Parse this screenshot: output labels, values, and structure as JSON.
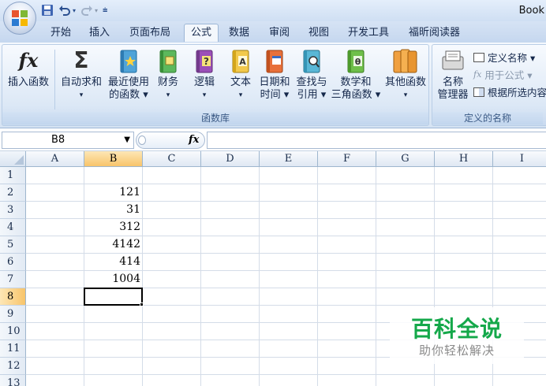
{
  "window": {
    "title": "Book"
  },
  "quick_access": {
    "icons": [
      "save-icon",
      "undo-icon",
      "redo-icon",
      "customize-icon"
    ]
  },
  "tabs": [
    {
      "label": "开始"
    },
    {
      "label": "插入"
    },
    {
      "label": "页面布局"
    },
    {
      "label": "公式",
      "active": true
    },
    {
      "label": "数据"
    },
    {
      "label": "审阅"
    },
    {
      "label": "视图"
    },
    {
      "label": "开发工具"
    },
    {
      "label": "福昕阅读器"
    }
  ],
  "ribbon": {
    "function_library": {
      "label": "函数库",
      "buttons": [
        {
          "line1": "插入函数",
          "line2": ""
        },
        {
          "line1": "自动求和",
          "line2": "▾"
        },
        {
          "line1": "最近使用",
          "line2": "的函数 ▾"
        },
        {
          "line1": "财务",
          "line2": "▾"
        },
        {
          "line1": "逻辑",
          "line2": "▾"
        },
        {
          "line1": "文本",
          "line2": "▾"
        },
        {
          "line1": "日期和",
          "line2": "时间 ▾"
        },
        {
          "line1": "查找与",
          "line2": "引用 ▾"
        },
        {
          "line1": "数学和",
          "line2": "三角函数 ▾"
        },
        {
          "line1": "其他函数",
          "line2": "▾"
        }
      ]
    },
    "defined_names": {
      "label": "定义的名称",
      "manager": {
        "line1": "名称",
        "line2": "管理器"
      },
      "define_name": "定义名称 ▾",
      "use_in_formula": "用于公式 ▾",
      "create_from_selection": "根据所选内容"
    }
  },
  "formula_bar": {
    "name_box": "B8",
    "fx_label": "fx",
    "formula": ""
  },
  "sheet": {
    "columns": [
      "A",
      "B",
      "C",
      "D",
      "E",
      "F",
      "G",
      "H",
      "I"
    ],
    "selected_column": "B",
    "rows": [
      "1",
      "2",
      "3",
      "4",
      "5",
      "6",
      "7",
      "8",
      "9",
      "10",
      "11",
      "12",
      "13"
    ],
    "selected_row": "8",
    "cells": {
      "B2": "121",
      "B3": "31",
      "B4": "312",
      "B5": "4142",
      "B6": "414",
      "B7": "1004"
    },
    "active_cell": "B8"
  },
  "watermark": {
    "title": "百科全说",
    "subtitle": "助你轻松解决"
  },
  "colors": {
    "accent": "#f8c46a",
    "ribbon_bg": "#dce8f6",
    "watermark_green": "#14a84a"
  }
}
